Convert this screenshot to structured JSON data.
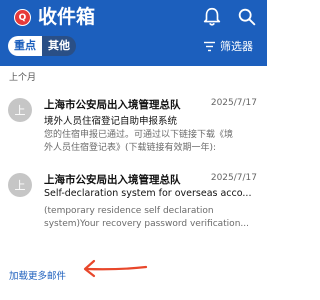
{
  "header": {
    "avatar_letter": "Q",
    "title": "收件箱",
    "tabs": [
      "重点",
      "其他"
    ],
    "filter_label": "筛选器",
    "colors": {
      "bar": "#1c5fbd",
      "avatar": "#e63a3a"
    }
  },
  "list": {
    "section_label": "上个月",
    "emails": [
      {
        "avatar_letter": "上",
        "sender": "上海市公安局出入境管理总队",
        "date": "2025/7/17",
        "subject": "境外人员住宿登记自助申报系统",
        "preview": [
          "您的住宿申报已通过。可通过以下链接下载《境",
          "外人员住宿登记表》(下载链接有效期一年):"
        ]
      },
      {
        "avatar_letter": "上",
        "sender": "上海市公安局出入境管理总队",
        "date": "2025/7/17",
        "subject": "Self-declaration system for overseas acco...",
        "preview": [
          "(temporary residence self declaration",
          "system)Your recovery password verification..."
        ]
      }
    ],
    "load_more": "加载更多邮件"
  },
  "annotation": {
    "color": "#e8472b"
  }
}
